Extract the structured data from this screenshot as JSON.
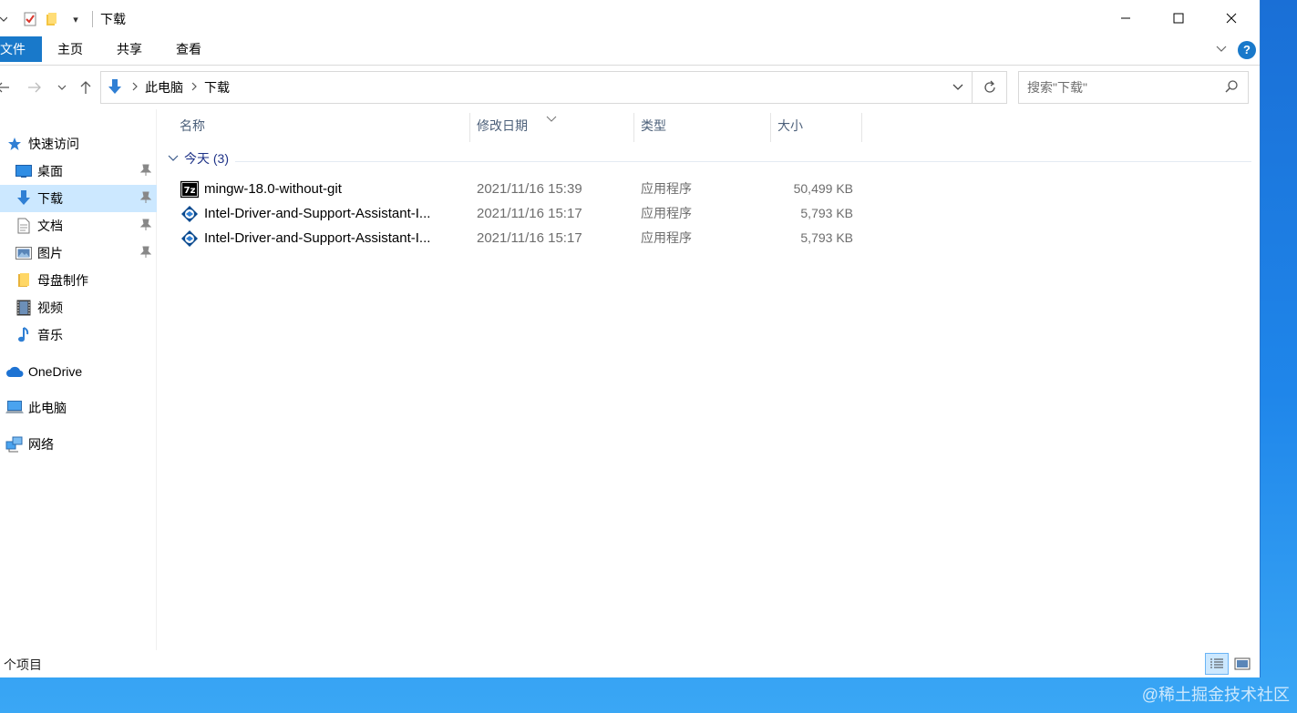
{
  "window": {
    "title": "下载",
    "qat_caret": "▾"
  },
  "ribbon": {
    "tabs": [
      "文件",
      "主页",
      "共享",
      "查看"
    ],
    "help_label": "?"
  },
  "navigation": {
    "breadcrumb": [
      "此电脑",
      "下载"
    ],
    "search_placeholder": "搜索\"下载\""
  },
  "sidebar": {
    "quick_access": "快速访问",
    "items": [
      {
        "label": "桌面",
        "icon": "desktop-icon",
        "pinned": true
      },
      {
        "label": "下载",
        "icon": "download-icon",
        "pinned": true,
        "selected": true
      },
      {
        "label": "文档",
        "icon": "document-icon",
        "pinned": true
      },
      {
        "label": "图片",
        "icon": "pictures-icon",
        "pinned": true
      },
      {
        "label": "母盘制作",
        "icon": "folder-icon",
        "pinned": false
      },
      {
        "label": "视频",
        "icon": "video-icon",
        "pinned": false
      },
      {
        "label": "音乐",
        "icon": "music-icon",
        "pinned": false
      }
    ],
    "onedrive": "OneDrive",
    "this_pc": "此电脑",
    "network": "网络"
  },
  "columns": {
    "name": "名称",
    "modified": "修改日期",
    "type": "类型",
    "size": "大小"
  },
  "group": {
    "label": "今天 (3)"
  },
  "files": [
    {
      "name": "mingw-18.0-without-git",
      "modified": "2021/11/16 15:39",
      "type": "应用程序",
      "size": "50,499 KB",
      "icon": "7zip-icon"
    },
    {
      "name": "Intel-Driver-and-Support-Assistant-I...",
      "modified": "2021/11/16 15:17",
      "type": "应用程序",
      "size": "5,793 KB",
      "icon": "intel-installer-icon"
    },
    {
      "name": "Intel-Driver-and-Support-Assistant-I...",
      "modified": "2021/11/16 15:17",
      "type": "应用程序",
      "size": "5,793 KB",
      "icon": "intel-installer-icon"
    }
  ],
  "status": {
    "count_text": "个项目"
  },
  "watermark": "@稀土掘金技术社区",
  "colors": {
    "accent": "#1979ca",
    "selection": "#cce8ff",
    "group_text": "#1e3287",
    "secondary_text": "#6d6d6d"
  }
}
